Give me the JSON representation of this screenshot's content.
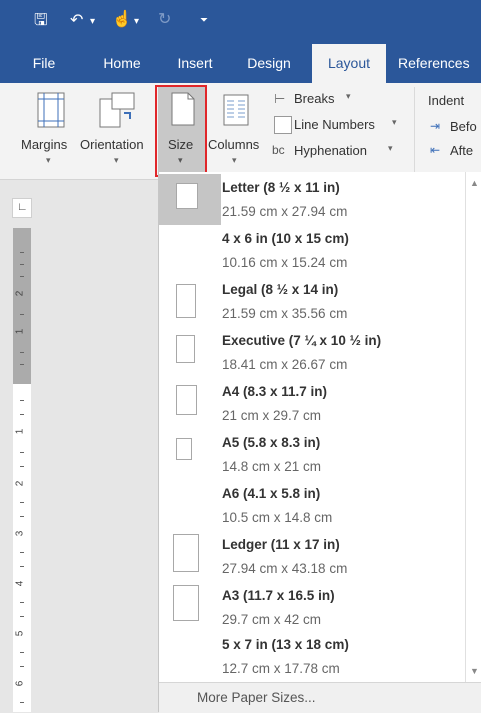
{
  "qat": {
    "save": "🖫",
    "undo": "↶",
    "touch": "☝",
    "redo": "↻",
    "more": "⏷"
  },
  "tabs": [
    "File",
    "Home",
    "Insert",
    "Design",
    "Layout",
    "References"
  ],
  "ribbon": {
    "margins": "Margins",
    "orientation": "Orientation",
    "size": "Size",
    "columns": "Columns",
    "breaks": "Breaks",
    "line_numbers": "Line Numbers",
    "hyphenation": "Hyphenation",
    "indent": "Indent",
    "before": "Befo",
    "after": "Afte"
  },
  "paper_sizes": [
    {
      "name": "Letter (8 ½ x 11 in)",
      "dims": "21.59 cm x 27.94 cm"
    },
    {
      "name": "4 x 6 in (10 x 15 cm)",
      "dims": "10.16 cm x 15.24 cm"
    },
    {
      "name": "Legal (8 ½ x 14 in)",
      "dims": "21.59 cm x 35.56 cm"
    },
    {
      "name": "Executive (7 ¼ x 10 ½ in)",
      "dims": "18.41 cm x 26.67 cm"
    },
    {
      "name": "A4 (8.3 x 11.7 in)",
      "dims": "21 cm x 29.7 cm"
    },
    {
      "name": "A5 (5.8 x 8.3 in)",
      "dims": "14.8 cm x 21 cm"
    },
    {
      "name": "A6 (4.1 x 5.8 in)",
      "dims": "10.5 cm x 14.8 cm"
    },
    {
      "name": "Ledger (11 x 17 in)",
      "dims": "27.94 cm x 43.18 cm"
    },
    {
      "name": "A3 (11.7 x 16.5 in)",
      "dims": "29.7 cm x 42 cm"
    },
    {
      "name": "5 x 7 in (13 x 18 cm)",
      "dims": "12.7 cm x 17.78 cm"
    }
  ],
  "more_sizes": "More Paper Sizes...",
  "ruler": [
    "2",
    "1",
    "1",
    "2",
    "3",
    "4",
    "5",
    "6"
  ],
  "colors": {
    "brand": "#2b579a",
    "highlight": "#e0262a"
  }
}
